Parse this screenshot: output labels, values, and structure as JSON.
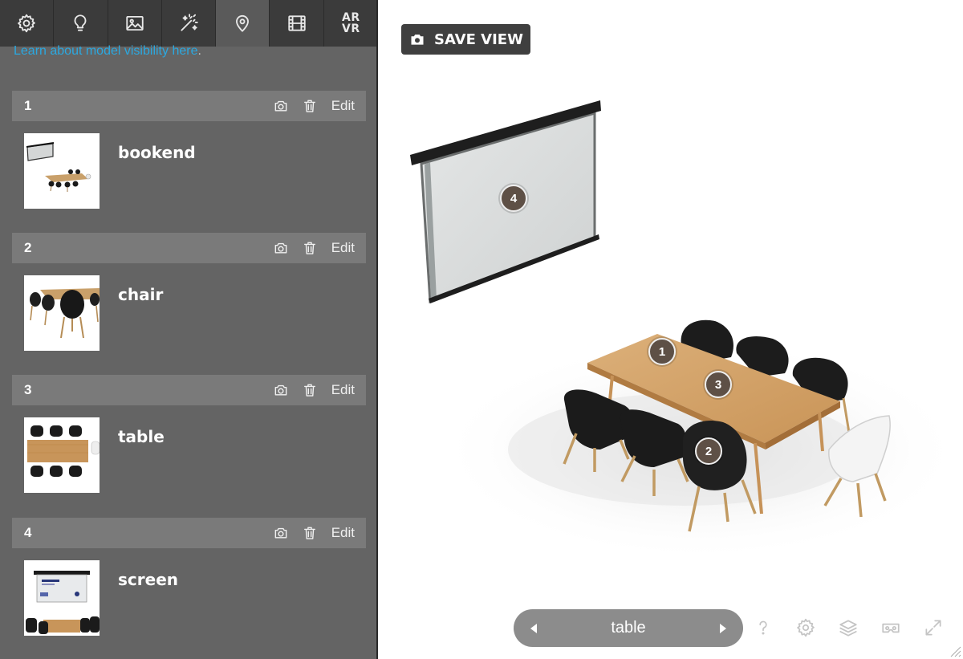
{
  "toolbar": {
    "tools": [
      {
        "name": "settings",
        "icon": "gear-icon"
      },
      {
        "name": "lighting",
        "icon": "lightbulb-icon"
      },
      {
        "name": "background",
        "icon": "image-icon"
      },
      {
        "name": "effects",
        "icon": "magic-wand-icon"
      },
      {
        "name": "annotations",
        "icon": "map-pin-icon",
        "active": true
      },
      {
        "name": "animation",
        "icon": "film-icon"
      },
      {
        "name": "ar-vr",
        "label_line1": "AR",
        "label_line2": "VR"
      }
    ]
  },
  "visibility_note": {
    "link_text": "Learn about model visibility here",
    "suffix": "."
  },
  "views": [
    {
      "number": "1",
      "name": "bookend",
      "edit_label": "Edit"
    },
    {
      "number": "2",
      "name": "chair",
      "edit_label": "Edit"
    },
    {
      "number": "3",
      "name": "table",
      "edit_label": "Edit"
    },
    {
      "number": "4",
      "name": "screen",
      "edit_label": "Edit"
    }
  ],
  "viewport": {
    "save_view_label": "SAVE VIEW",
    "hotspots": [
      "1",
      "2",
      "3",
      "4"
    ],
    "current_view": "table",
    "bottom_icons": [
      "help-icon",
      "settings-gear-icon",
      "layers-icon",
      "vr-headset-icon",
      "fullscreen-icon"
    ]
  },
  "colors": {
    "panel_bg": "#646464",
    "toolbar_bg": "#3b3b3b",
    "view_header_bg": "#7a7a7a",
    "link": "#2ba8e0",
    "save_view_bg": "#3f3f3f",
    "nav_pill_bg": "#8c8c8c",
    "hotspot_bg": "#5e5046"
  }
}
